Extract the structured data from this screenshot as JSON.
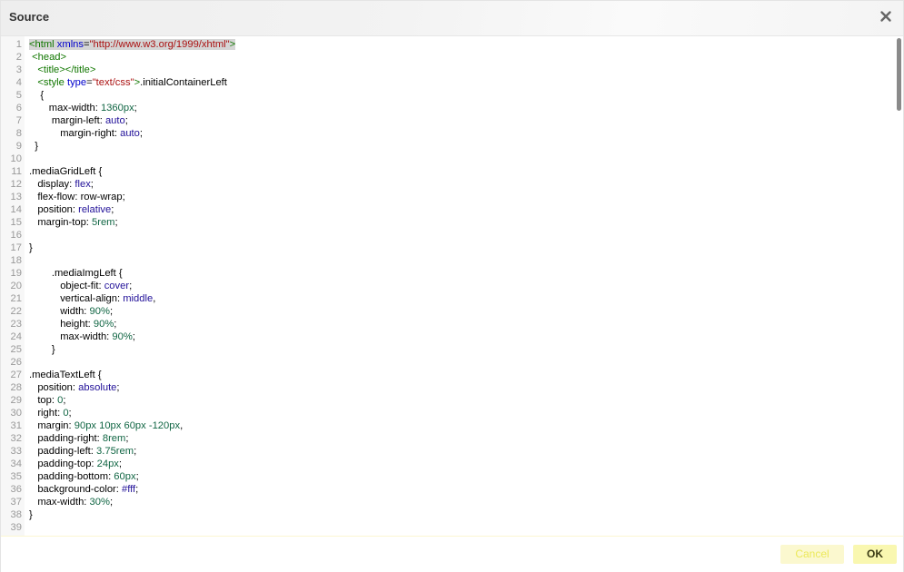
{
  "dialog": {
    "title": "Source",
    "close_icon": "close-icon"
  },
  "editor": {
    "lines": [
      {
        "n": "1",
        "segs": [
          {
            "t": "<html",
            "c": "tag"
          },
          {
            "t": " "
          },
          {
            "t": "xmlns",
            "c": "attr"
          },
          {
            "t": "="
          },
          {
            "t": "\"http://www.w3.org/1999/xhtml\"",
            "c": "str"
          },
          {
            "t": ">",
            "c": "tag"
          }
        ],
        "highlight": true
      },
      {
        "n": "2",
        "segs": [
          {
            "t": " "
          },
          {
            "t": "<head>",
            "c": "tag"
          }
        ]
      },
      {
        "n": "3",
        "segs": [
          {
            "t": "   "
          },
          {
            "t": "<title></title>",
            "c": "tag"
          }
        ]
      },
      {
        "n": "4",
        "segs": [
          {
            "t": "   "
          },
          {
            "t": "<style",
            "c": "tag"
          },
          {
            "t": " "
          },
          {
            "t": "type",
            "c": "attr"
          },
          {
            "t": "="
          },
          {
            "t": "\"text/css\"",
            "c": "str"
          },
          {
            "t": ">",
            "c": "tag"
          },
          {
            "t": ".initialContainerLeft"
          }
        ]
      },
      {
        "n": "5",
        "segs": [
          {
            "t": "    {"
          }
        ]
      },
      {
        "n": "6",
        "segs": [
          {
            "t": "       max-width: "
          },
          {
            "t": "1360px",
            "c": "num"
          },
          {
            "t": ";"
          }
        ]
      },
      {
        "n": "7",
        "segs": [
          {
            "t": "        margin-left: "
          },
          {
            "t": "auto",
            "c": "val"
          },
          {
            "t": ";"
          }
        ]
      },
      {
        "n": "8",
        "segs": [
          {
            "t": "           margin-right: "
          },
          {
            "t": "auto",
            "c": "val"
          },
          {
            "t": ";"
          }
        ]
      },
      {
        "n": "9",
        "segs": [
          {
            "t": "  }"
          }
        ]
      },
      {
        "n": "10",
        "segs": []
      },
      {
        "n": "11",
        "segs": [
          {
            "t": ".mediaGridLeft {"
          }
        ]
      },
      {
        "n": "12",
        "segs": [
          {
            "t": "   display: "
          },
          {
            "t": "flex",
            "c": "val"
          },
          {
            "t": ";"
          }
        ]
      },
      {
        "n": "13",
        "segs": [
          {
            "t": "   flex-flow: row-wrap;"
          }
        ]
      },
      {
        "n": "14",
        "segs": [
          {
            "t": "   position: "
          },
          {
            "t": "relative",
            "c": "val"
          },
          {
            "t": ";"
          }
        ]
      },
      {
        "n": "15",
        "segs": [
          {
            "t": "   margin-top: "
          },
          {
            "t": "5rem",
            "c": "num"
          },
          {
            "t": ";"
          }
        ]
      },
      {
        "n": "16",
        "segs": []
      },
      {
        "n": "17",
        "segs": [
          {
            "t": "}"
          }
        ]
      },
      {
        "n": "18",
        "segs": []
      },
      {
        "n": "19",
        "segs": [
          {
            "t": "        .mediaImgLeft {"
          }
        ]
      },
      {
        "n": "20",
        "segs": [
          {
            "t": "           object-fit: "
          },
          {
            "t": "cover",
            "c": "val"
          },
          {
            "t": ";"
          }
        ]
      },
      {
        "n": "21",
        "segs": [
          {
            "t": "           vertical-align: "
          },
          {
            "t": "middle",
            "c": "val"
          },
          {
            "t": ","
          }
        ]
      },
      {
        "n": "22",
        "segs": [
          {
            "t": "           width: "
          },
          {
            "t": "90%",
            "c": "num"
          },
          {
            "t": ";"
          }
        ]
      },
      {
        "n": "23",
        "segs": [
          {
            "t": "           height: "
          },
          {
            "t": "90%",
            "c": "num"
          },
          {
            "t": ";"
          }
        ]
      },
      {
        "n": "24",
        "segs": [
          {
            "t": "           max-width: "
          },
          {
            "t": "90%",
            "c": "num"
          },
          {
            "t": ";"
          }
        ]
      },
      {
        "n": "25",
        "segs": [
          {
            "t": "        }"
          }
        ]
      },
      {
        "n": "26",
        "segs": []
      },
      {
        "n": "27",
        "segs": [
          {
            "t": ".mediaTextLeft {"
          }
        ]
      },
      {
        "n": "28",
        "segs": [
          {
            "t": "   position: "
          },
          {
            "t": "absolute",
            "c": "val"
          },
          {
            "t": ";"
          }
        ]
      },
      {
        "n": "29",
        "segs": [
          {
            "t": "   top: "
          },
          {
            "t": "0",
            "c": "num"
          },
          {
            "t": ";"
          }
        ]
      },
      {
        "n": "30",
        "segs": [
          {
            "t": "   right: "
          },
          {
            "t": "0",
            "c": "num"
          },
          {
            "t": ";"
          }
        ]
      },
      {
        "n": "31",
        "segs": [
          {
            "t": "   margin: "
          },
          {
            "t": "90px 10px 60px -120px",
            "c": "num"
          },
          {
            "t": ","
          }
        ]
      },
      {
        "n": "32",
        "segs": [
          {
            "t": "   padding-right: "
          },
          {
            "t": "8rem",
            "c": "num"
          },
          {
            "t": ";"
          }
        ]
      },
      {
        "n": "33",
        "segs": [
          {
            "t": "   padding-left: "
          },
          {
            "t": "3.75rem",
            "c": "num"
          },
          {
            "t": ";"
          }
        ]
      },
      {
        "n": "34",
        "segs": [
          {
            "t": "   padding-top: "
          },
          {
            "t": "24px",
            "c": "num"
          },
          {
            "t": ";"
          }
        ]
      },
      {
        "n": "35",
        "segs": [
          {
            "t": "   padding-bottom: "
          },
          {
            "t": "60px",
            "c": "num"
          },
          {
            "t": ";"
          }
        ]
      },
      {
        "n": "36",
        "segs": [
          {
            "t": "   background-color: "
          },
          {
            "t": "#fff",
            "c": "val"
          },
          {
            "t": ";"
          }
        ]
      },
      {
        "n": "37",
        "segs": [
          {
            "t": "   max-width: "
          },
          {
            "t": "30%",
            "c": "num"
          },
          {
            "t": ";"
          }
        ]
      },
      {
        "n": "38",
        "segs": [
          {
            "t": "}"
          }
        ]
      },
      {
        "n": "39",
        "segs": []
      }
    ]
  },
  "footer": {
    "cancel_label": "Cancel",
    "ok_label": "OK"
  },
  "colors": {
    "tag": "#117700",
    "attribute": "#0000cc",
    "string": "#aa1111",
    "keyword_value": "#221199",
    "number": "#116644",
    "line_highlight": "#d5d5d5",
    "cancel_button_bg": "#fbf8cf",
    "ok_button_bg": "#f9f7b0"
  }
}
